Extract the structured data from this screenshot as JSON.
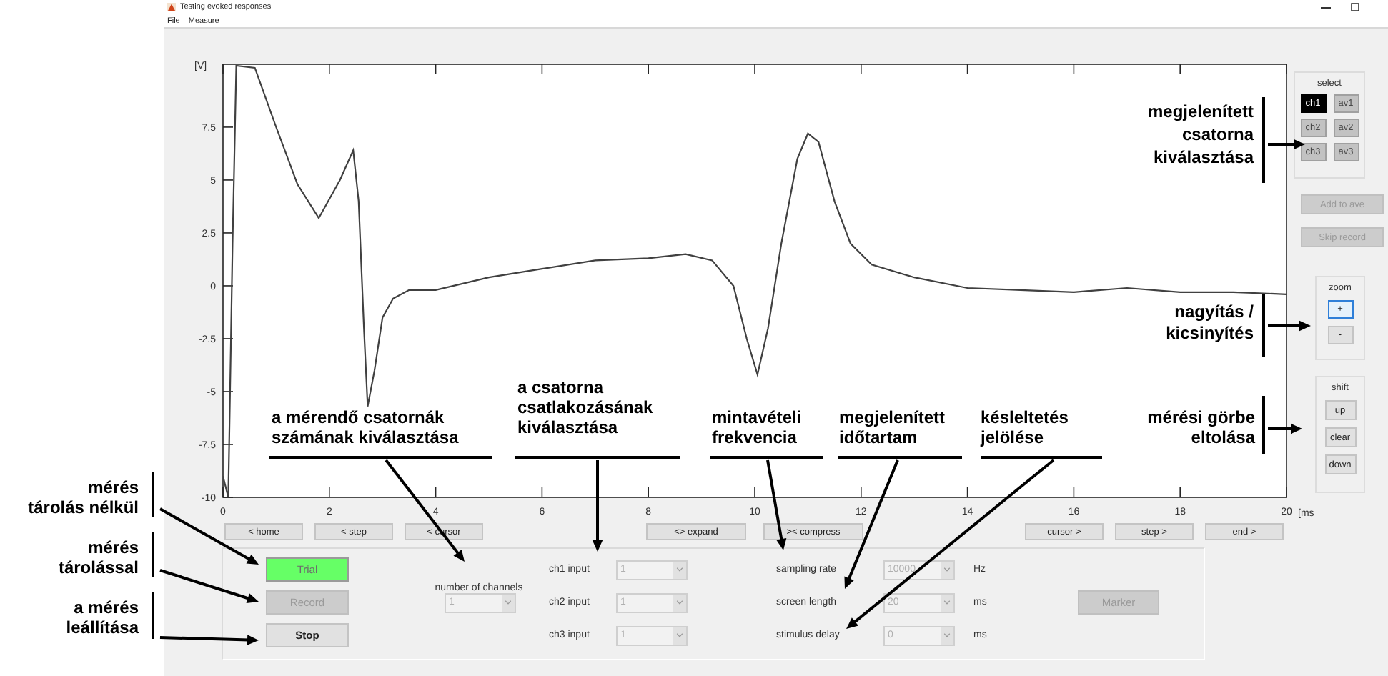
{
  "window": {
    "title": "Testing evoked responses"
  },
  "menu": [
    "File",
    "Measure"
  ],
  "chart": {
    "chart_data": {
      "type": "line",
      "ylabel": "[V]",
      "xlabel": "[ms",
      "x": [
        0,
        0.1,
        0.18,
        0.25,
        0.6,
        1.0,
        1.4,
        1.8,
        2.2,
        2.45,
        2.55,
        2.65,
        2.72,
        2.85,
        3.0,
        3.2,
        3.5,
        4.0,
        5.0,
        6.0,
        7.0,
        8.0,
        8.7,
        9.2,
        9.6,
        9.85,
        10.05,
        10.25,
        10.5,
        10.8,
        11.0,
        11.2,
        11.5,
        11.8,
        12.2,
        13,
        14,
        15,
        16,
        17,
        18,
        19,
        20
      ],
      "series": [
        {
          "color": "#404040",
          "values": [
            -9,
            -10,
            2,
            10.4,
            10.3,
            7.5,
            4.8,
            3.2,
            5,
            6.4,
            4,
            -2,
            -5.7,
            -4,
            -1.5,
            -0.6,
            -0.2,
            -0.2,
            0.4,
            0.8,
            1.2,
            1.3,
            1.5,
            1.2,
            0,
            -2.5,
            -4.2,
            -2,
            2,
            6,
            7.2,
            6.8,
            4,
            2,
            1,
            0.4,
            -0.1,
            -0.2,
            -0.3,
            -0.1,
            -0.3,
            -0.3,
            -0.4
          ]
        }
      ],
      "xlim": [
        0,
        20
      ],
      "ylim": [
        -10,
        10.47
      ],
      "xticks": [
        0,
        2,
        4,
        6,
        8,
        10,
        12,
        14,
        16,
        18,
        20
      ],
      "yticks": [
        -10,
        -7.5,
        -5,
        -2.5,
        0,
        2.5,
        5,
        7.5
      ]
    }
  },
  "nav_buttons": [
    "< home",
    "< step",
    "< cursor",
    "<> expand",
    "><  compress",
    "cursor >",
    "step >",
    "end >"
  ],
  "select": {
    "title": "select",
    "channels": [
      {
        "label": "ch1",
        "selected": true,
        "disabled": false
      },
      {
        "label": "av1",
        "selected": false,
        "disabled": true
      },
      {
        "label": "ch2",
        "selected": false,
        "disabled": true
      },
      {
        "label": "av2",
        "selected": false,
        "disabled": true
      },
      {
        "label": "ch3",
        "selected": false,
        "disabled": true
      },
      {
        "label": "av3",
        "selected": false,
        "disabled": true
      }
    ]
  },
  "add_to_ave": {
    "label": "Add to ave",
    "disabled": true
  },
  "skip_record": {
    "label": "Skip record",
    "disabled": true
  },
  "zoom": {
    "title": "zoom",
    "buttons": [
      {
        "label": "+",
        "focused": true
      },
      {
        "label": "-",
        "focused": false
      }
    ]
  },
  "shift": {
    "title": "shift",
    "buttons": [
      "up",
      "clear",
      "down"
    ]
  },
  "run_buttons": [
    {
      "label": "Trial",
      "highlighted": true,
      "disabled": false,
      "emphasized": false
    },
    {
      "label": "Record",
      "highlighted": false,
      "disabled": true,
      "emphasized": false
    },
    {
      "label": "Stop",
      "highlighted": false,
      "disabled": false,
      "emphasized": true
    }
  ],
  "channel_count": {
    "label": "number of channels",
    "value": "1",
    "disabled": true
  },
  "channel_inputs": [
    {
      "label": "ch1 input",
      "value": "1",
      "disabled": true
    },
    {
      "label": "ch2 input",
      "value": "1",
      "disabled": true
    },
    {
      "label": "ch3 input",
      "value": "1",
      "disabled": true
    }
  ],
  "settings": [
    {
      "label": "sampling rate",
      "value": "10000",
      "unit": "Hz",
      "disabled": true
    },
    {
      "label": "screen length",
      "value": "20",
      "unit": "ms",
      "disabled": true
    },
    {
      "label": "stimulus delay",
      "value": "0",
      "unit": "ms",
      "disabled": true
    }
  ],
  "marker_button": {
    "label": "Marker",
    "disabled": true
  },
  "annotations": [
    {
      "text": "megjelenített\ncsatorna\nkiválasztása"
    },
    {
      "text": "nagyítás /\nkicsinyítés"
    },
    {
      "text": "a csatorna\ncsatlakozásának\nkiválasztása"
    },
    {
      "text": "a mérendő csatornák\nszámának kiválasztása"
    },
    {
      "text": "mintavételi\nfrekvencia"
    },
    {
      "text": "megjelenített\nidőtartam"
    },
    {
      "text": "késleltetés\njelölése"
    },
    {
      "text": "mérési görbe\neltolása"
    },
    {
      "text": "mérés\ntárolás nélkül"
    },
    {
      "text": "mérés\ntárolással"
    },
    {
      "text": "a mérés\nleállítása"
    }
  ]
}
